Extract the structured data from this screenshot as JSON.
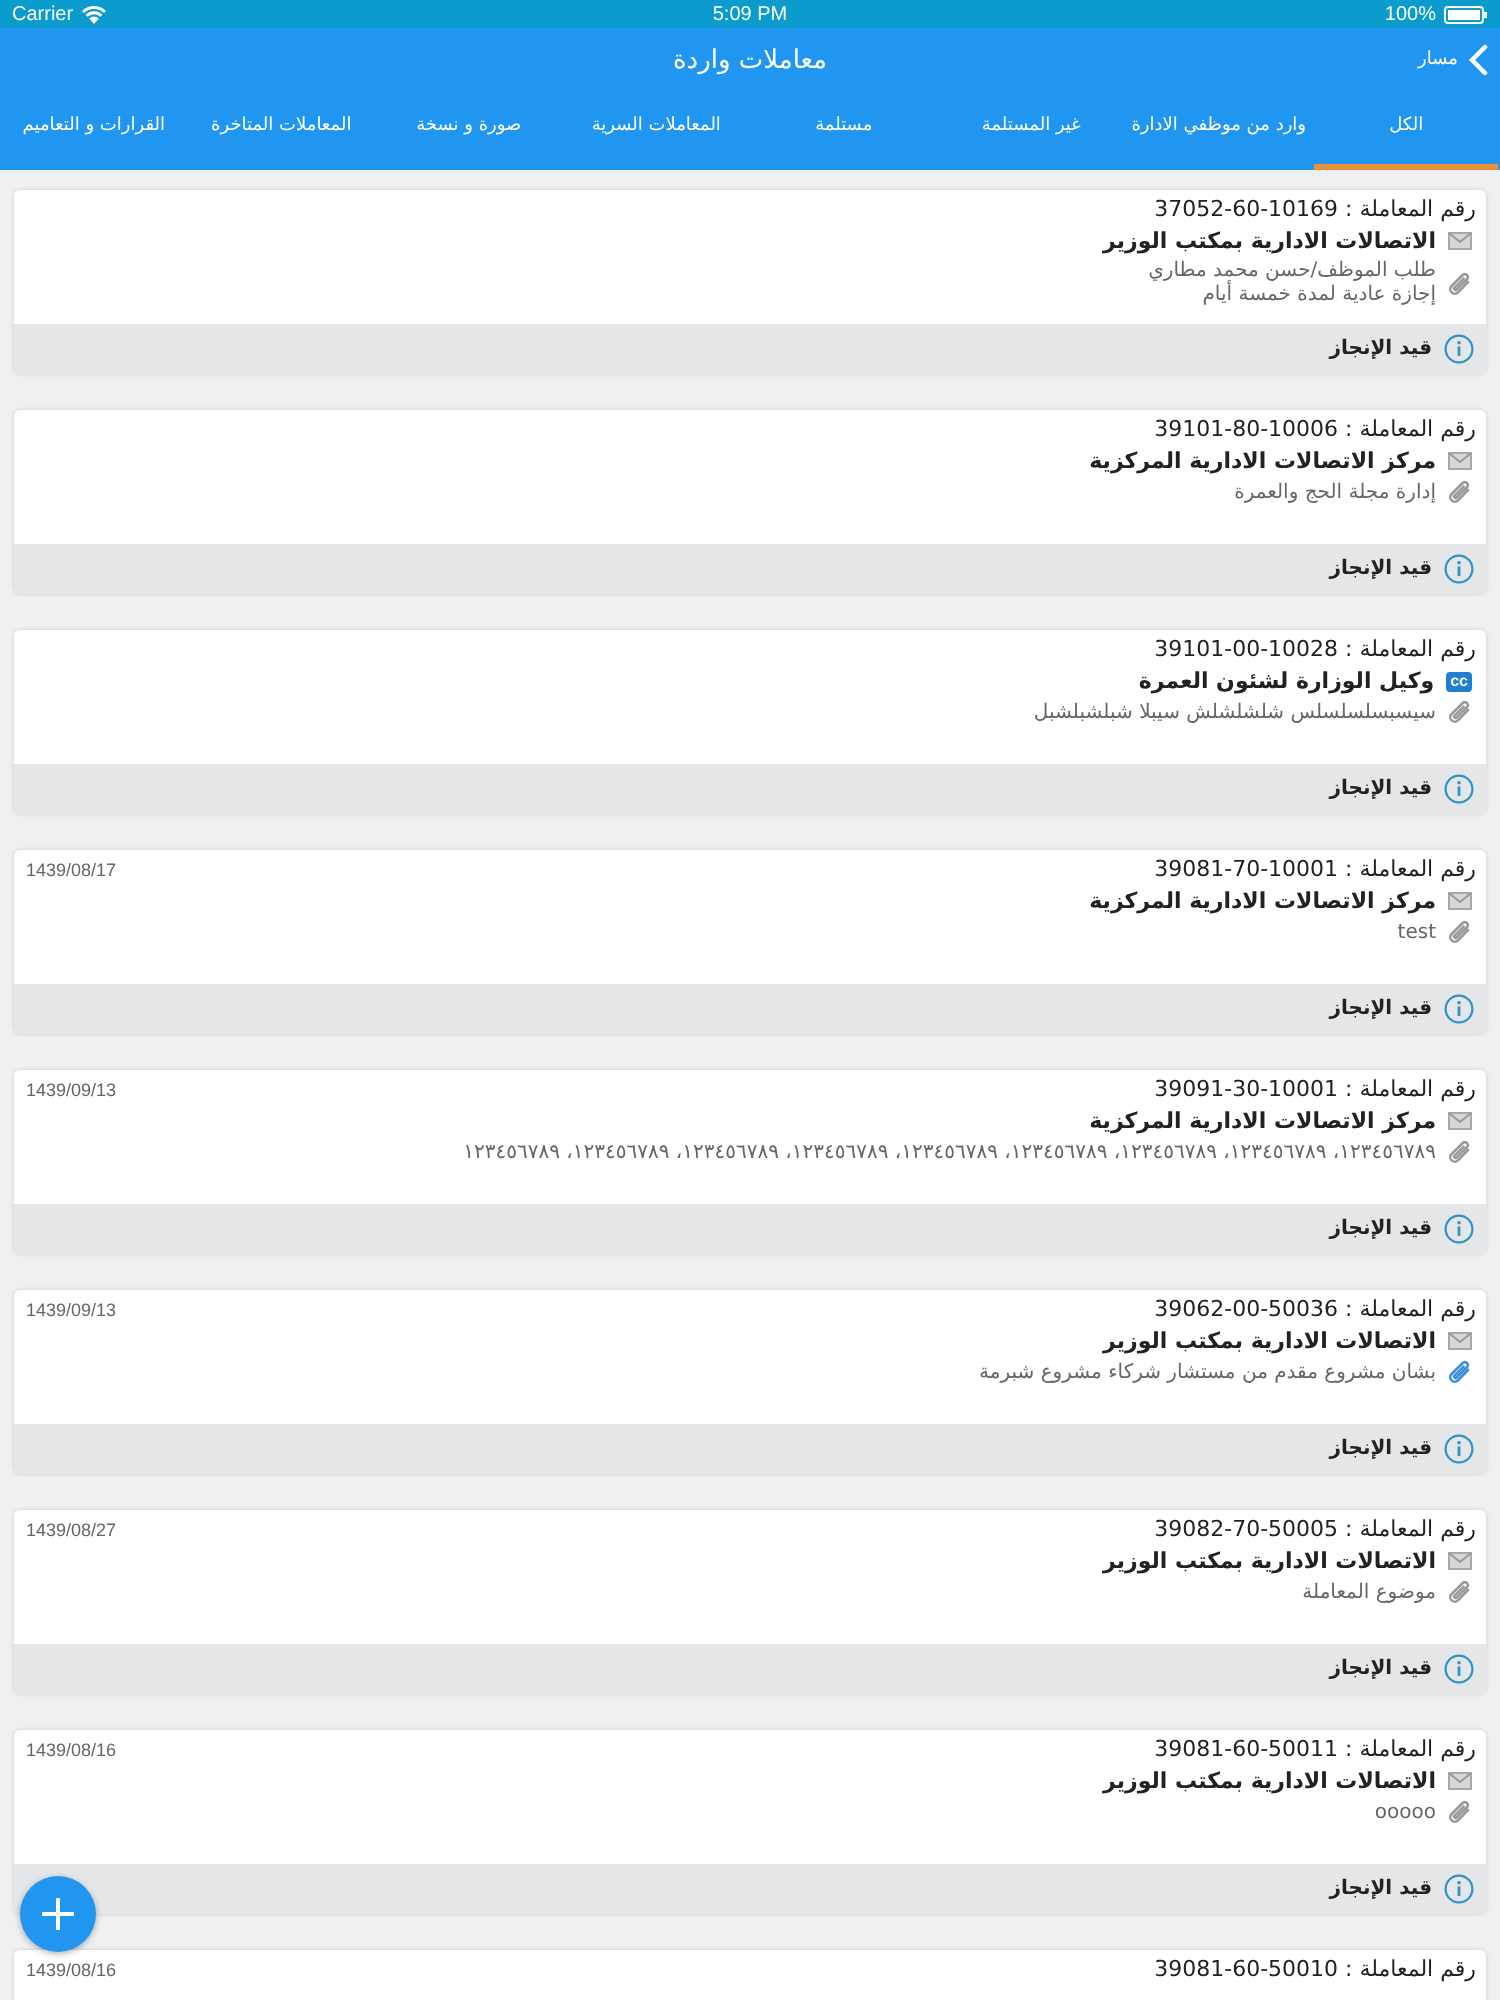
{
  "status_bar": {
    "carrier": "Carrier",
    "time": "5:09 PM",
    "battery": "100%"
  },
  "nav": {
    "back_label": "مسار",
    "title": "معاملات واردة"
  },
  "tabs": [
    {
      "label": "الكل",
      "selected": true
    },
    {
      "label": "وارد من موظفي الادارة",
      "selected": false
    },
    {
      "label": "غير المستلمة",
      "selected": false
    },
    {
      "label": "مستلمة",
      "selected": false
    },
    {
      "label": "المعاملات السرية",
      "selected": false
    },
    {
      "label": "صورة و نسخة",
      "selected": false
    },
    {
      "label": "المعاملات المتاخرة",
      "selected": false
    },
    {
      "label": "القرارات و التعاميم",
      "selected": false
    }
  ],
  "transactions": [
    {
      "number_label": "رقم المعاملة :",
      "number": "37052-60-10169",
      "kind": "mail",
      "sender": "الاتصالات الادارية بمكتب الوزير",
      "subject_lines": [
        "طلب الموظف/حسن محمد مطاري",
        "إجازة عادية لمدة خمسة أيام"
      ],
      "attachment_highlighted": false,
      "status": "قيد الإنجاز"
    },
    {
      "number_label": "رقم المعاملة :",
      "number": "39101-80-10006",
      "kind": "mail",
      "sender": "مركز الاتصالات الادارية المركزية",
      "subject_lines": [
        "إدارة مجلة الحج والعمرة"
      ],
      "attachment_highlighted": false,
      "status": "قيد الإنجاز"
    },
    {
      "number_label": "رقم المعاملة :",
      "number": "39101-00-10028",
      "kind": "cc",
      "badge": "cc",
      "sender": "وكيل الوزارة لشئون العمرة",
      "subject_lines": [
        "سيسبسلسلسلس شلشلشلش سيبلا  شبلشبلشبل"
      ],
      "attachment_highlighted": false,
      "status": "قيد الإنجاز"
    },
    {
      "number_label": "رقم المعاملة :",
      "number": "39081-70-10001",
      "date": "1439/08/17",
      "kind": "mail",
      "sender": "مركز الاتصالات الادارية المركزية",
      "subject_lines": [
        "test"
      ],
      "attachment_highlighted": false,
      "status": "قيد الإنجاز"
    },
    {
      "number_label": "رقم المعاملة :",
      "number": "39091-30-10001",
      "date": "1439/09/13",
      "kind": "mail",
      "sender": "مركز الاتصالات الادارية المركزية",
      "subject_lines": [
        "١٢٣٤٥٦٧٨٩، ١٢٣٤٥٦٧٨٩، ١٢٣٤٥٦٧٨٩، ١٢٣٤٥٦٧٨٩، ١٢٣٤٥٦٧٨٩، ١٢٣٤٥٦٧٨٩، ١٢٣٤٥٦٧٨٩، ١٢٣٤٥٦٧٨٩، ١٢٣٤٥٦٧٨٩"
      ],
      "attachment_highlighted": false,
      "status": "قيد الإنجاز"
    },
    {
      "number_label": "رقم المعاملة :",
      "number": "39062-00-50036",
      "date": "1439/09/13",
      "kind": "mail",
      "sender": "الاتصالات الادارية بمكتب الوزير",
      "subject_lines": [
        "بشان مشروع مقدم من مستشار شركاء مشروع شبرمة"
      ],
      "attachment_highlighted": true,
      "status": "قيد الإنجاز"
    },
    {
      "number_label": "رقم المعاملة :",
      "number": "39082-70-50005",
      "date": "1439/08/27",
      "kind": "mail",
      "sender": "الاتصالات الادارية بمكتب الوزير",
      "subject_lines": [
        "موضوع المعاملة"
      ],
      "attachment_highlighted": false,
      "status": "قيد الإنجاز"
    },
    {
      "number_label": "رقم المعاملة :",
      "number": "39081-60-50011",
      "date": "1439/08/16",
      "kind": "mail",
      "sender": "الاتصالات الادارية بمكتب الوزير",
      "subject_lines": [
        "ooooo"
      ],
      "attachment_highlighted": false,
      "status": "قيد الإنجاز"
    },
    {
      "number_label": "رقم المعاملة :",
      "number": "39081-60-50010",
      "date": "1439/08/16"
    }
  ]
}
